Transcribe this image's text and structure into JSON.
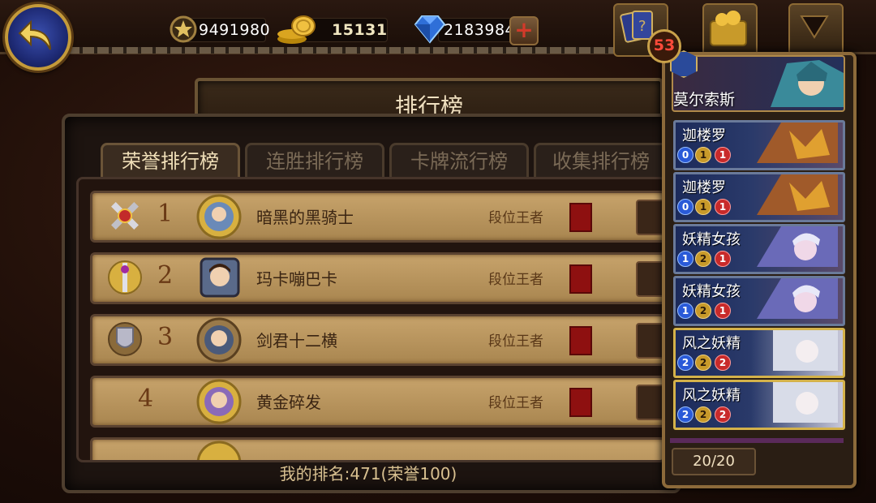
{
  "top_bar": {
    "stars": "9491980",
    "gold": "15131",
    "gems": "2183984",
    "deck_badge": "53"
  },
  "title": "排行榜",
  "tabs": [
    {
      "label": "荣誉排行榜",
      "active": true
    },
    {
      "label": "连胜排行榜",
      "active": false
    },
    {
      "label": "卡牌流行榜",
      "active": false
    },
    {
      "label": "收集排行榜",
      "active": false
    }
  ],
  "rows": [
    {
      "rank": "1",
      "name": "暗黑的黑骑士",
      "tier": "段位王者"
    },
    {
      "rank": "2",
      "name": "玛卡嘣巴卡",
      "tier": "段位王者"
    },
    {
      "rank": "3",
      "name": "剑君十二横",
      "tier": "段位王者"
    },
    {
      "rank": "4",
      "name": "黄金碎发",
      "tier": "段位王者"
    }
  ],
  "my_rank": "我的排名:471(荣誉100)",
  "deck": {
    "hero_name": "莫尔索斯",
    "cards": [
      {
        "name": "迦楼罗",
        "cost": "0",
        "atk": "1",
        "hp": "1",
        "gold": false
      },
      {
        "name": "迦楼罗",
        "cost": "0",
        "atk": "1",
        "hp": "1",
        "gold": false
      },
      {
        "name": "妖精女孩",
        "cost": "1",
        "atk": "2",
        "hp": "1",
        "gold": false
      },
      {
        "name": "妖精女孩",
        "cost": "1",
        "atk": "2",
        "hp": "1",
        "gold": false
      },
      {
        "name": "风之妖精",
        "cost": "2",
        "atk": "2",
        "hp": "2",
        "gold": true
      },
      {
        "name": "风之妖精",
        "cost": "2",
        "atk": "2",
        "hp": "2",
        "gold": true
      }
    ],
    "count": "20/20"
  },
  "colors": {
    "accent": "#c49a3a",
    "row_bg": "#b89560",
    "rank_text": "#6a3a16",
    "flag": "#8e1010"
  }
}
